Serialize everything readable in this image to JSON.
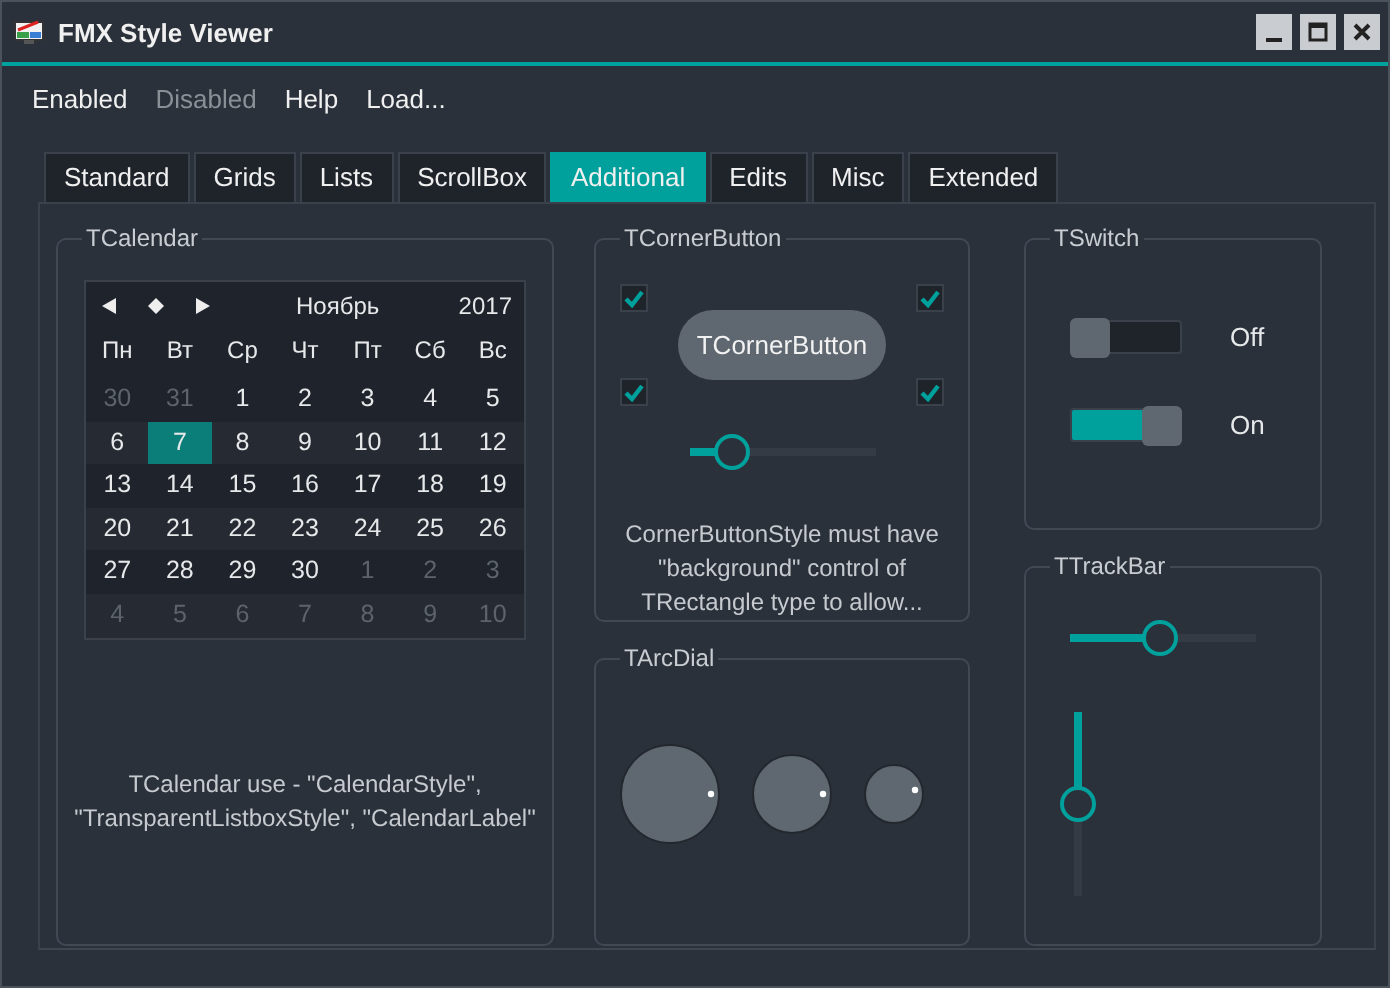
{
  "window": {
    "title": "FMX Style Viewer"
  },
  "menu": [
    {
      "label": "Enabled",
      "disabled": false
    },
    {
      "label": "Disabled",
      "disabled": true
    },
    {
      "label": "Help",
      "disabled": false
    },
    {
      "label": "Load...",
      "disabled": false
    }
  ],
  "tabs": [
    {
      "label": "Standard",
      "selected": false
    },
    {
      "label": "Grids",
      "selected": false
    },
    {
      "label": "Lists",
      "selected": false
    },
    {
      "label": "ScrollBox",
      "selected": false
    },
    {
      "label": "Additional",
      "selected": true
    },
    {
      "label": "Edits",
      "selected": false
    },
    {
      "label": "Misc",
      "selected": false
    },
    {
      "label": "Extended",
      "selected": false
    }
  ],
  "calendar_group": {
    "title": "TCalendar",
    "calendar": {
      "month": "Ноябрь",
      "year": "2017",
      "weekdays": [
        "Пн",
        "Вт",
        "Ср",
        "Чт",
        "Пт",
        "Сб",
        "Вс"
      ],
      "weeks": [
        {
          "days": [
            {
              "day": "30",
              "in_month": false,
              "selected": false
            },
            {
              "day": "31",
              "in_month": false,
              "selected": false
            },
            {
              "day": "1",
              "in_month": true,
              "selected": false
            },
            {
              "day": "2",
              "in_month": true,
              "selected": false
            },
            {
              "day": "3",
              "in_month": true,
              "selected": false
            },
            {
              "day": "4",
              "in_month": true,
              "selected": false
            },
            {
              "day": "5",
              "in_month": true,
              "selected": false
            }
          ]
        },
        {
          "days": [
            {
              "day": "6",
              "in_month": true,
              "selected": false
            },
            {
              "day": "7",
              "in_month": true,
              "selected": true
            },
            {
              "day": "8",
              "in_month": true,
              "selected": false
            },
            {
              "day": "9",
              "in_month": true,
              "selected": false
            },
            {
              "day": "10",
              "in_month": true,
              "selected": false
            },
            {
              "day": "11",
              "in_month": true,
              "selected": false
            },
            {
              "day": "12",
              "in_month": true,
              "selected": false
            }
          ]
        },
        {
          "days": [
            {
              "day": "13",
              "in_month": true,
              "selected": false
            },
            {
              "day": "14",
              "in_month": true,
              "selected": false
            },
            {
              "day": "15",
              "in_month": true,
              "selected": false
            },
            {
              "day": "16",
              "in_month": true,
              "selected": false
            },
            {
              "day": "17",
              "in_month": true,
              "selected": false
            },
            {
              "day": "18",
              "in_month": true,
              "selected": false
            },
            {
              "day": "19",
              "in_month": true,
              "selected": false
            }
          ]
        },
        {
          "days": [
            {
              "day": "20",
              "in_month": true,
              "selected": false
            },
            {
              "day": "21",
              "in_month": true,
              "selected": false
            },
            {
              "day": "22",
              "in_month": true,
              "selected": false
            },
            {
              "day": "23",
              "in_month": true,
              "selected": false
            },
            {
              "day": "24",
              "in_month": true,
              "selected": false
            },
            {
              "day": "25",
              "in_month": true,
              "selected": false
            },
            {
              "day": "26",
              "in_month": true,
              "selected": false
            }
          ]
        },
        {
          "days": [
            {
              "day": "27",
              "in_month": true,
              "selected": false
            },
            {
              "day": "28",
              "in_month": true,
              "selected": false
            },
            {
              "day": "29",
              "in_month": true,
              "selected": false
            },
            {
              "day": "30",
              "in_month": true,
              "selected": false
            },
            {
              "day": "1",
              "in_month": false,
              "selected": false
            },
            {
              "day": "2",
              "in_month": false,
              "selected": false
            },
            {
              "day": "3",
              "in_month": false,
              "selected": false
            }
          ]
        },
        {
          "days": [
            {
              "day": "4",
              "in_month": false,
              "selected": false
            },
            {
              "day": "5",
              "in_month": false,
              "selected": false
            },
            {
              "day": "6",
              "in_month": false,
              "selected": false
            },
            {
              "day": "7",
              "in_month": false,
              "selected": false
            },
            {
              "day": "8",
              "in_month": false,
              "selected": false
            },
            {
              "day": "9",
              "in_month": false,
              "selected": false
            },
            {
              "day": "10",
              "in_month": false,
              "selected": false
            }
          ]
        }
      ]
    },
    "description": "TCalendar use - \"CalendarStyle\", \"TransparentListboxStyle\", \"CalendarLabel\""
  },
  "corner_group": {
    "title": "TCornerButton",
    "checkboxes": [
      {
        "checked": true
      },
      {
        "checked": true
      },
      {
        "checked": true
      },
      {
        "checked": true
      }
    ],
    "button": "TCornerButton",
    "slider": {
      "level": 0.23
    },
    "description": "CornerButtonStyle must have \"background\" control of TRectangle type to allow..."
  },
  "arcdial_group": {
    "title": "TArcDial"
  },
  "switch_group": {
    "title": "TSwitch",
    "switches": [
      {
        "label": "Off",
        "on": false
      },
      {
        "label": "On",
        "on": true
      }
    ]
  },
  "trackbar_group": {
    "title": "TTrackBar",
    "trackbars": [
      {
        "kind": "horizontal",
        "level": 0.48
      },
      {
        "kind": "vertical",
        "level": 0.5
      }
    ]
  }
}
